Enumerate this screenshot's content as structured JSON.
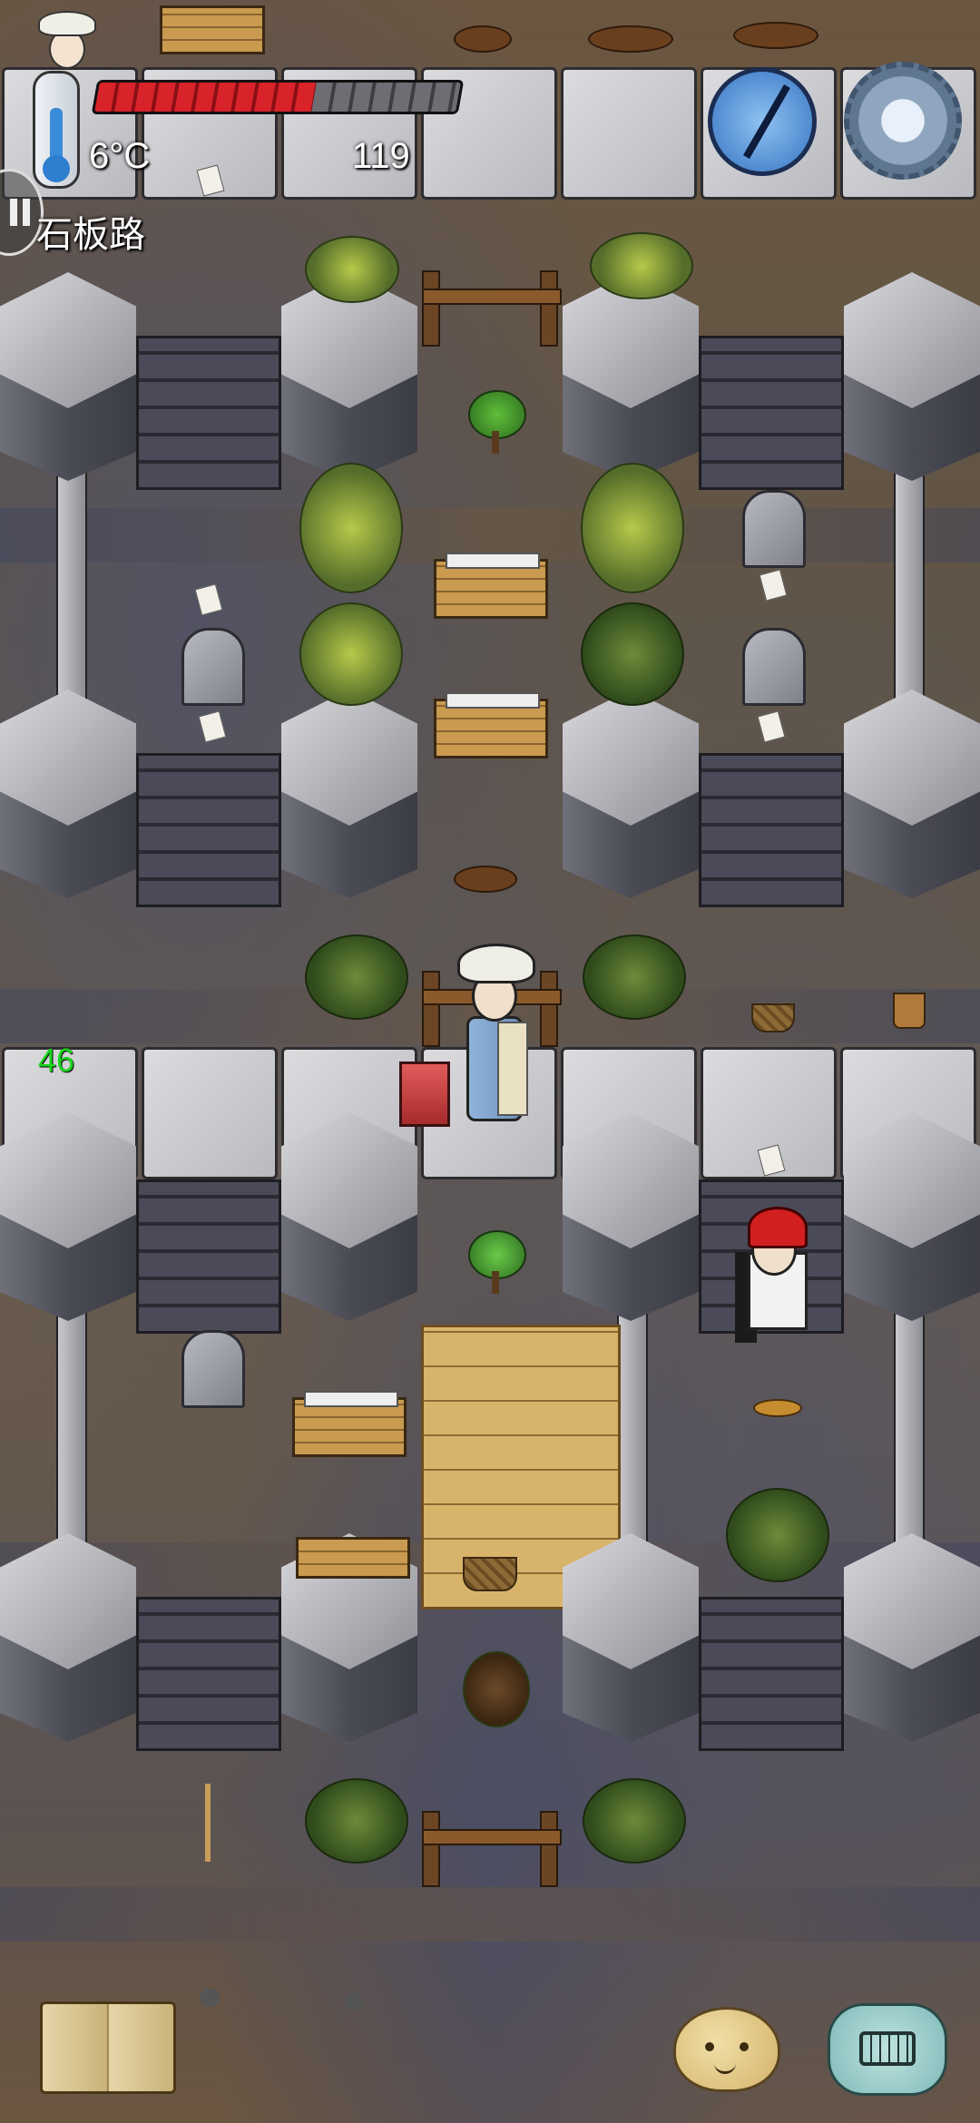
{
  "hud": {
    "temperature": "6°C",
    "counter": "119",
    "location": "石板路",
    "health_fraction": 0.6,
    "small_counter": "46"
  },
  "icons": {
    "compass": "compass-icon",
    "settings": "gear-icon",
    "journal": "book-icon",
    "emote": "emote-face-icon",
    "chat": "keyboard-chat-icon",
    "pause": "pause-icon",
    "thermometer": "thermometer-icon"
  },
  "colors": {
    "health": "#d8232a",
    "counter_green": "#19d51b",
    "text": "#ffffff"
  }
}
